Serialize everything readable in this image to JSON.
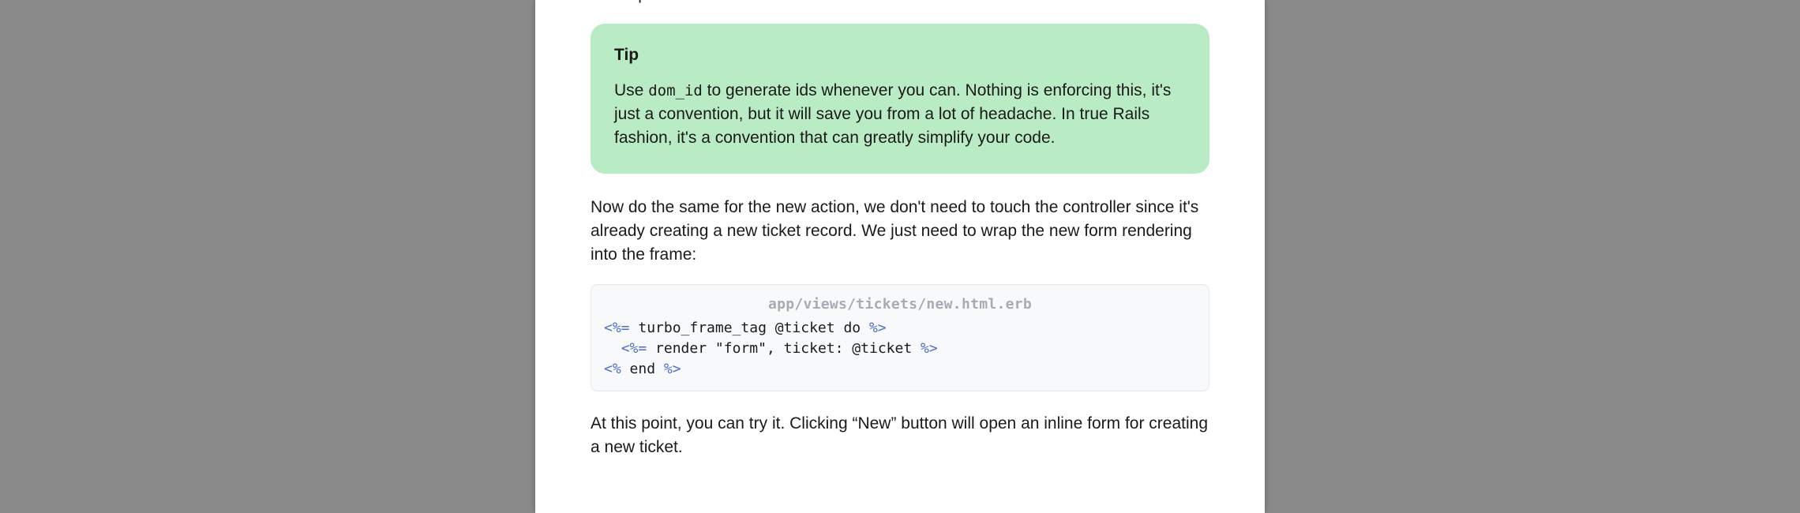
{
  "cut_top_text": "future proof our code.",
  "tip": {
    "title": "Tip",
    "body_prefix": "Use ",
    "code": "dom_id",
    "body_suffix": " to generate ids whenever you can. Nothing is enforcing this, it's just a convention, but it will save you from a lot of headache. In true Rails fashion, it's a convention that can greatly simplify your code."
  },
  "para1": "Now do the same for the new action, we don't need to touch the controller since it's already creating a new ticket record. We just need to wrap the new form rendering into the frame:",
  "code_block": {
    "path": "app/views/tickets/new.html.erb",
    "line1_open": "<%=",
    "line1_rest": " turbo_frame_tag @ticket do ",
    "line1_close": "%>",
    "line2_indent": "  ",
    "line2_open": "<%=",
    "line2_rest1": " render ",
    "line2_str": "\"form\"",
    "line2_rest2": ", ticket: @ticket ",
    "line2_close": "%>",
    "line3_open": "<%",
    "line3_rest": " end ",
    "line3_close": "%>"
  },
  "para2": "At this point, you can try it. Clicking “New” button will open an inline form for creating a new ticket."
}
